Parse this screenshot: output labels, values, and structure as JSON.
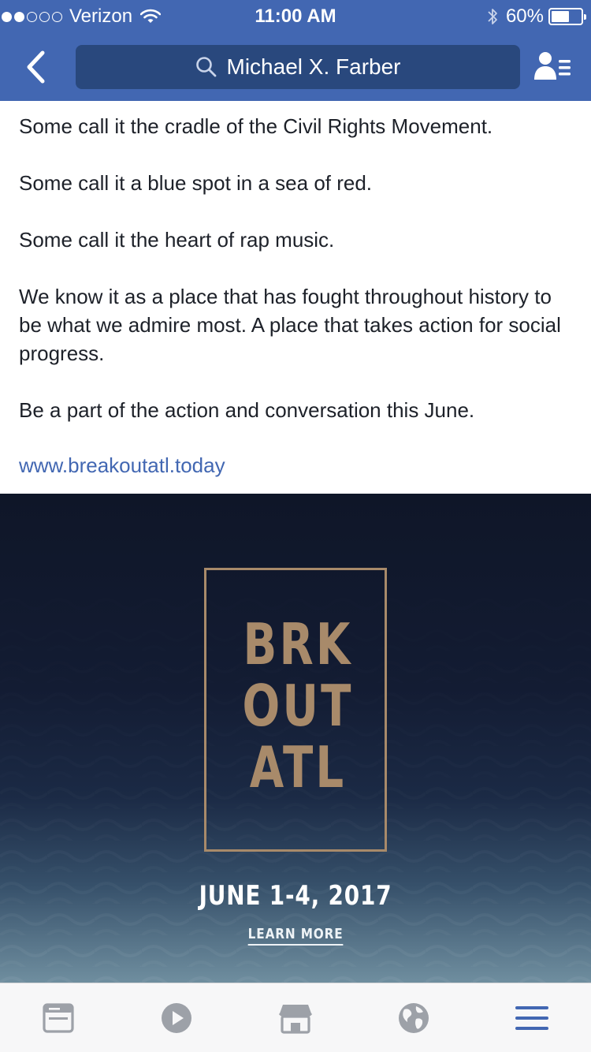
{
  "status_bar": {
    "carrier": "Verizon",
    "time": "11:00 AM",
    "battery_percent": "60%",
    "battery_level": 0.6,
    "signal_strength": 2,
    "signal_max": 5
  },
  "nav": {
    "back_icon": "chevron-left-icon",
    "search_icon": "search-icon",
    "search_text": "Michael X. Farber",
    "profile_icon": "friends-list-icon"
  },
  "post": {
    "paragraphs": [
      "Some call it the cradle of the Civil Rights Movement.",
      "Some call it a blue spot in a sea of red.",
      "Some call it the heart of rap music.",
      "We know it as a place that has fought throughout history to be what we admire most. A place that takes action for social progress.",
      "Be a part of the action and conversation this June."
    ],
    "link": "www.breakoutatl.today"
  },
  "ad": {
    "logo_lines": [
      "BRK",
      "OUT",
      "ATL"
    ],
    "date": "JUNE 1-4, 2017",
    "cta": "LEARN MORE"
  },
  "tab_bar": {
    "tabs": [
      {
        "icon": "news-feed-icon",
        "active": false
      },
      {
        "icon": "video-play-icon",
        "active": false
      },
      {
        "icon": "marketplace-icon",
        "active": false
      },
      {
        "icon": "globe-notifications-icon",
        "active": false
      },
      {
        "icon": "menu-icon",
        "active": true
      }
    ]
  },
  "colors": {
    "brand_blue": "#4267b2",
    "search_bg": "#29487d",
    "link_blue": "#4267b2",
    "logo_gold": "#a88a6a",
    "tab_inactive": "#9da1a8",
    "tab_active": "#4267b2"
  }
}
